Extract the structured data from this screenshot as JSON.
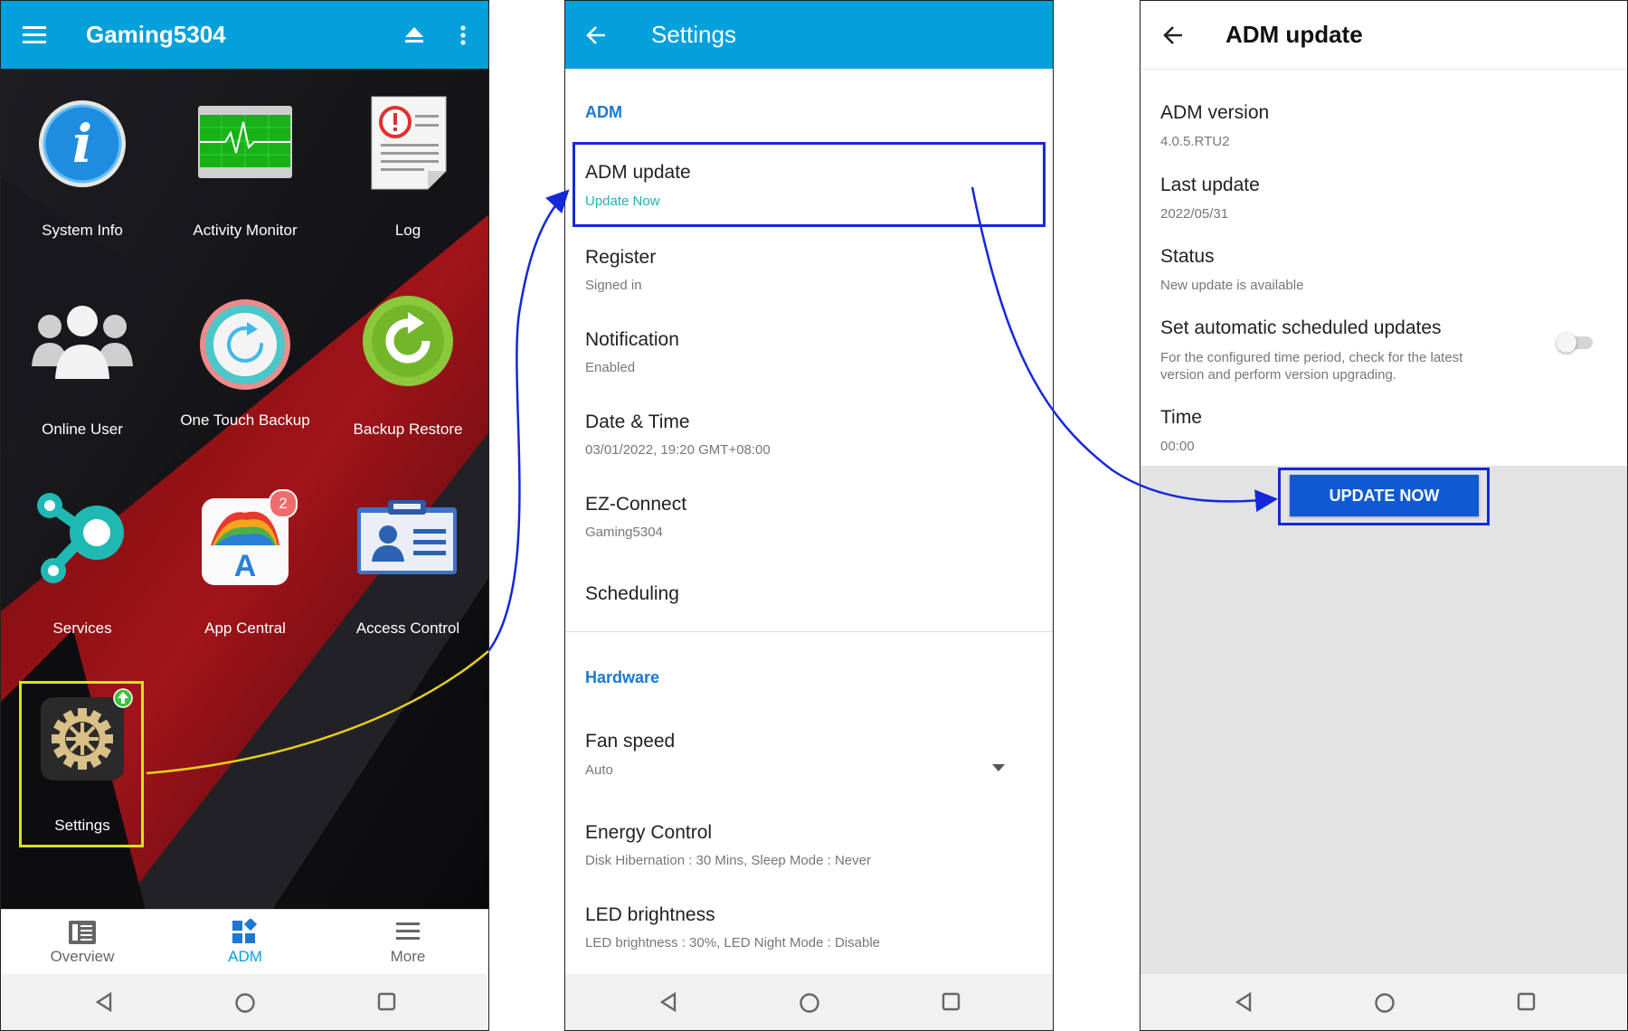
{
  "panel1": {
    "title": "Gaming5304",
    "apps": [
      {
        "label": "System Info"
      },
      {
        "label": "Activity Monitor"
      },
      {
        "label": "Log"
      },
      {
        "label": "Online User"
      },
      {
        "label": "One Touch Backup"
      },
      {
        "label": "Backup Restore"
      },
      {
        "label": "Services"
      },
      {
        "label": "App Central",
        "badge": "2"
      },
      {
        "label": "Access Control"
      },
      {
        "label": "Settings"
      }
    ],
    "tabs": [
      {
        "label": "Overview"
      },
      {
        "label": "ADM",
        "active": true
      },
      {
        "label": "More"
      }
    ]
  },
  "panel2": {
    "title": "Settings",
    "sections": {
      "adm": "ADM",
      "hardware": "Hardware"
    },
    "items": {
      "adm_update": {
        "title": "ADM update",
        "sub": "Update Now"
      },
      "register": {
        "title": "Register",
        "sub": "Signed in"
      },
      "notification": {
        "title": "Notification",
        "sub": "Enabled"
      },
      "datetime": {
        "title": "Date & Time",
        "sub": "03/01/2022, 19:20 GMT+08:00"
      },
      "ezconnect": {
        "title": "EZ-Connect",
        "sub": "Gaming5304"
      },
      "scheduling": {
        "title": "Scheduling"
      },
      "fan": {
        "title": "Fan speed",
        "sub": "Auto"
      },
      "energy": {
        "title": "Energy Control",
        "sub": "Disk Hibernation : 30 Mins, Sleep Mode : Never"
      },
      "led": {
        "title": "LED brightness",
        "sub": "LED brightness : 30%, LED Night Mode : Disable"
      }
    }
  },
  "panel3": {
    "title": "ADM update",
    "version": {
      "title": "ADM version",
      "value": "4.0.5.RTU2"
    },
    "last": {
      "title": "Last update",
      "value": "2022/05/31"
    },
    "status": {
      "title": "Status",
      "value": "New update is available"
    },
    "auto": {
      "title": "Set automatic scheduled updates",
      "desc": "For the configured time period, check for the latest version and perform version upgrading.",
      "enabled": false
    },
    "time": {
      "title": "Time",
      "value": "00:00"
    },
    "button": "UPDATE NOW"
  },
  "colors": {
    "appbar": "#03a0dc",
    "highlight_yellow": "#d7e21e",
    "highlight_blue": "#1428d8",
    "section_blue": "#1c78d4",
    "update_teal": "#17b5b0",
    "button_blue": "#0f5ad2"
  }
}
